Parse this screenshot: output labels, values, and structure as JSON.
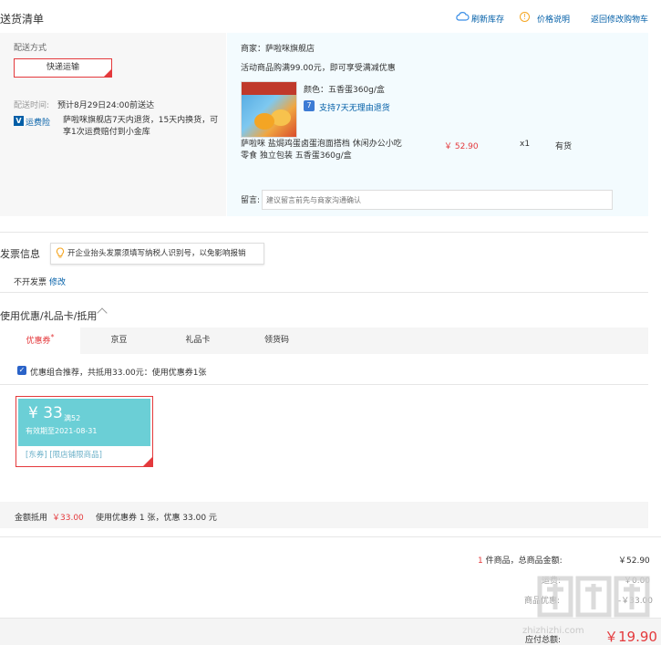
{
  "header": {
    "title": "送货清单",
    "refresh": "刷新库存",
    "price_info": "价格说明",
    "back_cart": "返回修改购物车"
  },
  "delivery": {
    "method_label": "配送方式",
    "method_value": "快递运输",
    "time_label": "配送时间:",
    "time_value": "预计8月29日24:00前送达",
    "service_name": "运费险",
    "service_desc": "萨啦咪旗舰店7天内退货，15天内换货，可享1次运费赔付到小金库"
  },
  "shop": {
    "seller": "商家：萨啦咪旗舰店",
    "promo": "活动商品购满99.00元，即可享受满减优惠",
    "color": "颜色：五香蛋360g/盒",
    "return_policy": "支持7天无理由退货",
    "product_name": "萨啦咪 盐焗鸡蛋卤蛋泡面搭档 休闲办公小吃零食 独立包装 五香蛋360g/盒",
    "price": "￥ 52.90",
    "qty": "x1",
    "stock": "有货",
    "remark_label": "留言:",
    "remark_placeholder": "建议留言前先与商家沟通确认"
  },
  "invoice": {
    "title": "发票信息",
    "tip": "开企业抬头发票须填写纳税人识别号，以免影响报销",
    "value": "不开发票",
    "edit": "修改"
  },
  "coupons": {
    "title": "使用优惠/礼品卡/抵用",
    "tabs": [
      "优惠券",
      "京豆",
      "礼品卡",
      "领货码"
    ],
    "combo": "优惠组合推荐，共抵用33.00元：使用优惠券1张",
    "card": {
      "amount": "¥ 33",
      "condition": "满52",
      "expiry": "有效期至2021-08-31",
      "tags": "[东券] [限店铺限商品]"
    },
    "summary_label": "金额抵用",
    "summary_amount": "￥33.00",
    "summary_detail": "使用优惠券 1 张，优惠 33.00 元"
  },
  "totals": {
    "count_num": "1",
    "count_label": " 件商品，总商品金额:",
    "total": "￥52.90",
    "row2_label": "运费:",
    "row2_value": "￥0.00",
    "row3_label": "商品优惠:",
    "row3_value": "-￥33.00",
    "pay_label": "应付总额:",
    "pay_amount": "￥19.90"
  },
  "watermark": "zhizhizhi.com",
  "icons": [
    "cloud-icon",
    "info-icon",
    "insurance-icon",
    "return-icon",
    "bulb-icon",
    "chevron-up-icon",
    "checkbox-icon"
  ],
  "colors": {
    "accent_red": "#e4393c",
    "link_blue": "#005ea7",
    "coupon_teal": "#6bcfd6"
  }
}
